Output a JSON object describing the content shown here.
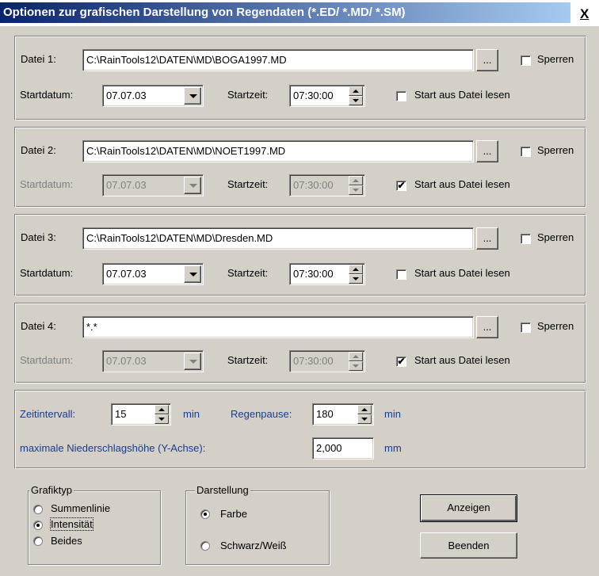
{
  "window": {
    "title": "Optionen zur grafischen Darstellung von Regendaten (*.ED/ *.MD/ *.SM)",
    "close": "X"
  },
  "files": [
    {
      "label": "Datei 1:",
      "path": "C:\\RainTools12\\DATEN\\MD\\BOGA1997.MD",
      "browse": "...",
      "lock_label": "Sperren",
      "date_label": "Startdatum:",
      "date": "07.07.03",
      "time_label": "Startzeit:",
      "time": "07:30:00",
      "read_label": "Start aus Datei lesen",
      "read_checked": ""
    },
    {
      "label": "Datei 2:",
      "path": "C:\\RainTools12\\DATEN\\MD\\NOET1997.MD",
      "browse": "...",
      "lock_label": "Sperren",
      "date_label": "Startdatum:",
      "date": "07.07.03",
      "time_label": "Startzeit:",
      "time": "07:30:00",
      "read_label": "Start aus Datei lesen",
      "read_checked": "✔"
    },
    {
      "label": "Datei 3:",
      "path": "C:\\RainTools12\\DATEN\\MD\\Dresden.MD",
      "browse": "...",
      "lock_label": "Sperren",
      "date_label": "Startdatum:",
      "date": "07.07.03",
      "time_label": "Startzeit:",
      "time": "07:30:00",
      "read_label": "Start aus Datei lesen",
      "read_checked": ""
    },
    {
      "label": "Datei 4:",
      "path": "*.*",
      "browse": "...",
      "lock_label": "Sperren",
      "date_label": "Startdatum:",
      "date": "07.07.03",
      "time_label": "Startzeit:",
      "time": "07:30:00",
      "read_label": "Start aus Datei lesen",
      "read_checked": "✔"
    }
  ],
  "params": {
    "interval_label": "Zeitintervall:",
    "interval": "15",
    "interval_unit": "min",
    "pause_label": "Regenpause:",
    "pause": "180",
    "pause_unit": "min",
    "max_label": "maximale Niederschlagshöhe (Y-Achse):",
    "max": "2,000",
    "max_unit": "mm"
  },
  "grafiktyp": {
    "title": "Grafiktyp",
    "options": [
      "Summenlinie",
      "Intensität",
      "Beides"
    ],
    "selected": "Intensität"
  },
  "darstellung": {
    "title": "Darstellung",
    "options": [
      "Farbe",
      "Schwarz/Weiß"
    ],
    "selected": "Farbe"
  },
  "buttons": {
    "show": "Anzeigen",
    "close": "Beenden"
  },
  "colors": {
    "title_start": "#0a246a",
    "title_end": "#a6caf0",
    "label_blue": "#1a3c8c",
    "face": "#d4d0c8"
  }
}
